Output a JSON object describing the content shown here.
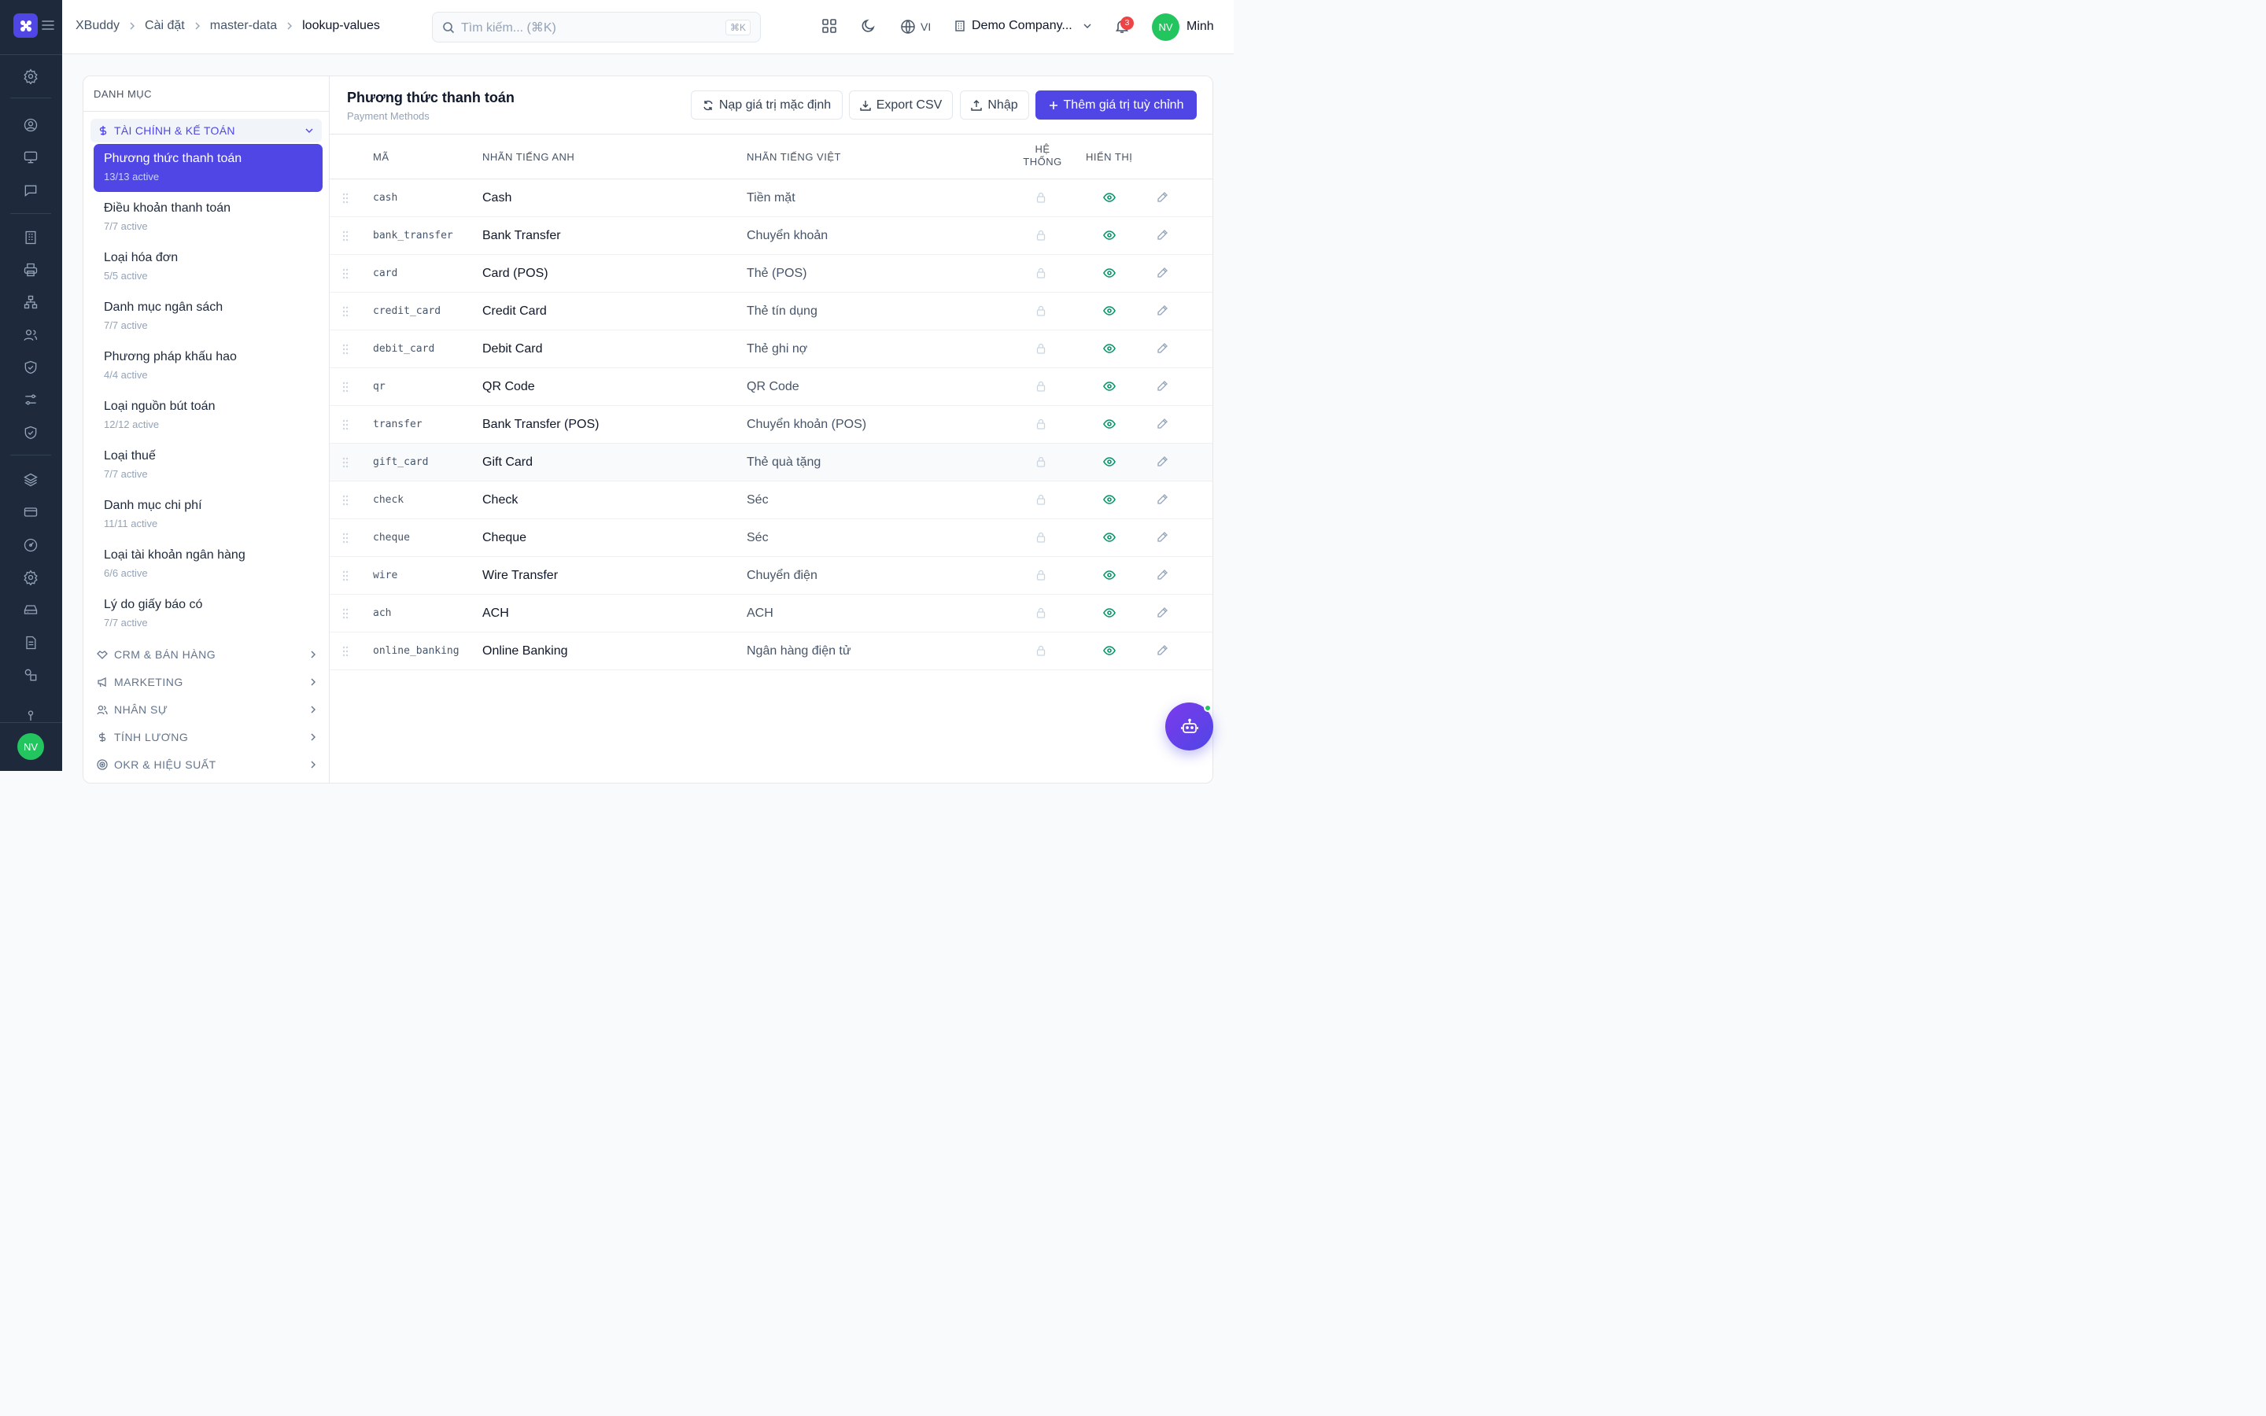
{
  "rail": {
    "avatar": "NV"
  },
  "breadcrumb": [
    "XBuddy",
    "Cài đặt",
    "master-data",
    "lookup-values"
  ],
  "search": {
    "placeholder": "Tìm kiếm... (⌘K)",
    "shortcut": "⌘K"
  },
  "topbar": {
    "language": "VI",
    "company": "Demo Company...",
    "notifications": "3",
    "user_initials": "NV",
    "user_name": "Minh"
  },
  "sidebar": {
    "header": "DANH MỤC",
    "open_group": "TÀI CHÍNH & KẾ TOÁN",
    "categories": [
      {
        "name": "Phương thức thanh toán",
        "count": "13/13 active"
      },
      {
        "name": "Điều khoản thanh toán",
        "count": "7/7 active"
      },
      {
        "name": "Loại hóa đơn",
        "count": "5/5 active"
      },
      {
        "name": "Danh mục ngân sách",
        "count": "7/7 active"
      },
      {
        "name": "Phương pháp khấu hao",
        "count": "4/4 active"
      },
      {
        "name": "Loại nguồn bút toán",
        "count": "12/12 active"
      },
      {
        "name": "Loại thuế",
        "count": "7/7 active"
      },
      {
        "name": "Danh mục chi phí",
        "count": "11/11 active"
      },
      {
        "name": "Loại tài khoản ngân hàng",
        "count": "6/6 active"
      },
      {
        "name": "Lý do giấy báo có",
        "count": "7/7 active"
      }
    ],
    "groups": [
      {
        "label": "CRM & BÁN HÀNG",
        "icon": "handshake-icon"
      },
      {
        "label": "MARKETING",
        "icon": "megaphone-icon"
      },
      {
        "label": "NHÂN SỰ",
        "icon": "users-icon"
      },
      {
        "label": "TÍNH LƯƠNG",
        "icon": "dollar-icon"
      },
      {
        "label": "OKR & HIỆU SUẤT",
        "icon": "target-icon"
      }
    ]
  },
  "main": {
    "title": "Phương thức thanh toán",
    "subtitle": "Payment Methods",
    "buttons": {
      "reset": "Nạp giá trị mặc định",
      "export": "Export CSV",
      "import": "Nhập",
      "add": "Thêm giá trị tuỳ chỉnh"
    },
    "columns": {
      "code": "MÃ",
      "en": "NHÃN TIẾNG ANH",
      "vi": "NHÃN TIẾNG VIỆT",
      "system": "HỆ THỐNG",
      "visible": "HIỂN THỊ"
    },
    "rows": [
      {
        "code": "cash",
        "en": "Cash",
        "vi": "Tiền mặt"
      },
      {
        "code": "bank_transfer",
        "en": "Bank Transfer",
        "vi": "Chuyển khoản"
      },
      {
        "code": "card",
        "en": "Card (POS)",
        "vi": "Thẻ (POS)"
      },
      {
        "code": "credit_card",
        "en": "Credit Card",
        "vi": "Thẻ tín dụng"
      },
      {
        "code": "debit_card",
        "en": "Debit Card",
        "vi": "Thẻ ghi nợ"
      },
      {
        "code": "qr",
        "en": "QR Code",
        "vi": "QR Code"
      },
      {
        "code": "transfer",
        "en": "Bank Transfer (POS)",
        "vi": "Chuyển khoản (POS)"
      },
      {
        "code": "gift_card",
        "en": "Gift Card",
        "vi": "Thẻ quà tặng"
      },
      {
        "code": "check",
        "en": "Check",
        "vi": "Séc"
      },
      {
        "code": "cheque",
        "en": "Cheque",
        "vi": "Séc"
      },
      {
        "code": "wire",
        "en": "Wire Transfer",
        "vi": "Chuyển điện"
      },
      {
        "code": "ach",
        "en": "ACH",
        "vi": "ACH"
      },
      {
        "code": "online_banking",
        "en": "Online Banking",
        "vi": "Ngân hàng điện tử"
      }
    ]
  },
  "colors": {
    "accent": "#4f46e5",
    "rail": "#1e293b",
    "visible_icon": "#059669",
    "avatar": "#22c55e",
    "badge": "#ef4444"
  }
}
